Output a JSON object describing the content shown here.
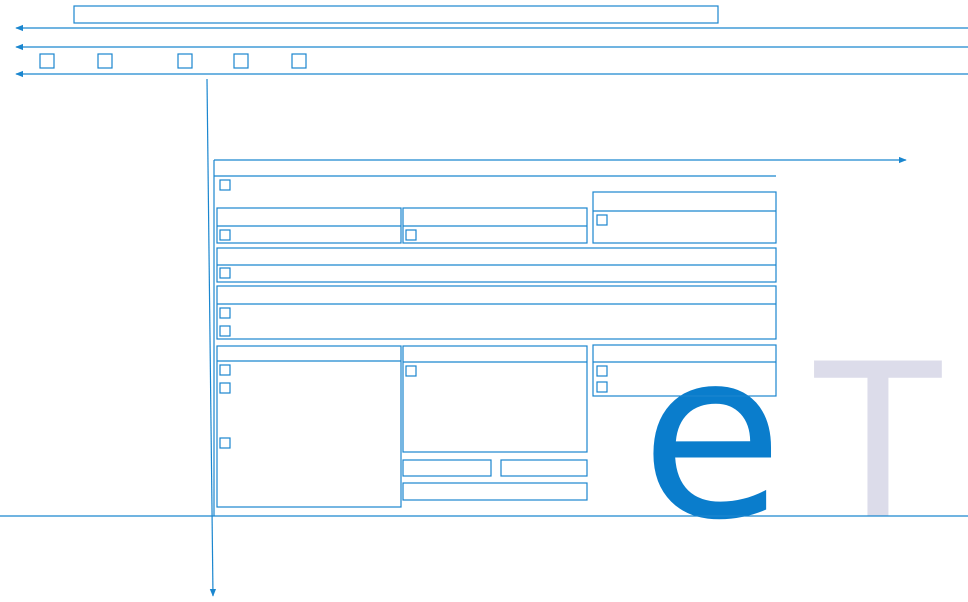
{
  "colors": {
    "line": "#1a86cf",
    "brand_e": "#0a7dcc",
    "brand_t": "#dcdcea",
    "background": "#ffffff"
  },
  "logo": {
    "letter_e": "e",
    "letter_t": "T"
  }
}
